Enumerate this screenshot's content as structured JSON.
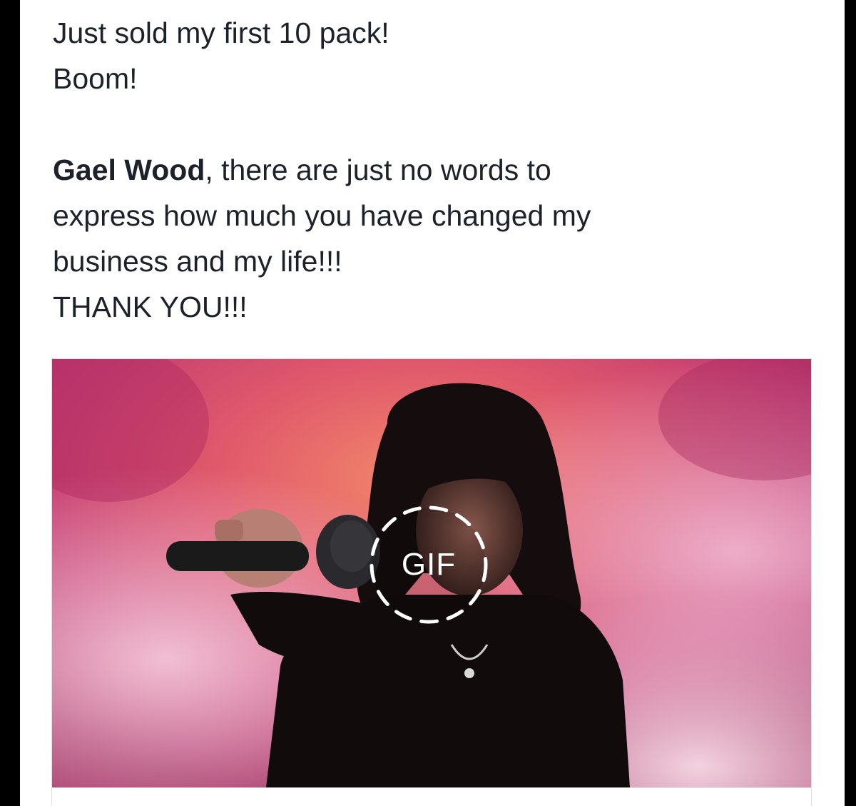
{
  "post": {
    "lines": {
      "line1": "Just sold my first 10 pack!",
      "line2": "Boom!",
      "mention": "Gael Wood",
      "line3_rest": ", there are just no words to",
      "line4": "express how much you have changed my",
      "line5": "business and my life!!!",
      "line6": "THANK YOU!!!"
    }
  },
  "attachment": {
    "type_label": "GIF",
    "play_icon": "dashed-circle-play-icon"
  },
  "colors": {
    "text": "#1d2129",
    "background_accent": "#c4326a",
    "frame": "#000000"
  }
}
